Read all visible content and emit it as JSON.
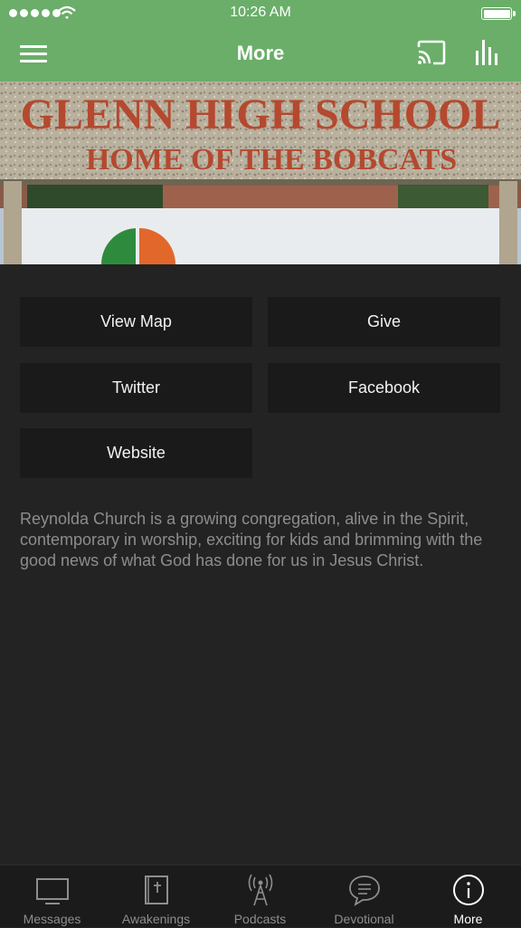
{
  "status_bar": {
    "time": "10:26 AM"
  },
  "nav": {
    "title": "More",
    "menu_icon": "hamburger-menu-icon",
    "cast_icon": "cast-icon",
    "audio_icon": "audio-bars-icon"
  },
  "hero": {
    "sign_line1": "GLENN HIGH SCHOOL",
    "sign_line2": "HOME OF THE BOBCATS"
  },
  "buttons": {
    "view_map": "View Map",
    "give": "Give",
    "twitter": "Twitter",
    "facebook": "Facebook",
    "website": "Website"
  },
  "description": "Reynolda Church is a growing congregation, alive in the Spirit, contemporary in worship, exciting for kids and brimming with the good news of what God has done for us in Jesus Christ.",
  "tabs": [
    {
      "label": "Messages",
      "icon": "tv-icon"
    },
    {
      "label": "Awakenings",
      "icon": "bible-icon"
    },
    {
      "label": "Podcasts",
      "icon": "broadcast-tower-icon"
    },
    {
      "label": "Devotional",
      "icon": "chat-bubble-icon"
    },
    {
      "label": "More",
      "icon": "info-icon",
      "active": true
    }
  ],
  "colors": {
    "header_green": "#6aae69",
    "background": "#232323",
    "button_bg": "#1a1a1a",
    "text_muted": "#8d8d8d"
  }
}
